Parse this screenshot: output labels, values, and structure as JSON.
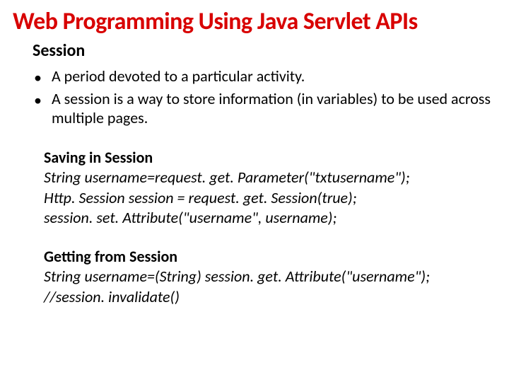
{
  "title": "Web Programming Using Java Servlet APIs",
  "subtitle": "Session",
  "bullets": [
    "A period devoted to a particular activity.",
    "A session is a way to store information (in variables) to be used across multiple pages."
  ],
  "section1": {
    "heading": "Saving in Session",
    "lines": [
      "String username=request. get. Parameter(\"txtusername\");",
      "Http. Session session = request. get. Session(true);",
      "session. set. Attribute(\"username\", username);"
    ]
  },
  "section2": {
    "heading": "Getting from Session",
    "lines": [
      "String username=(String) session. get. Attribute(\"username\");",
      "//session. invalidate()"
    ]
  }
}
